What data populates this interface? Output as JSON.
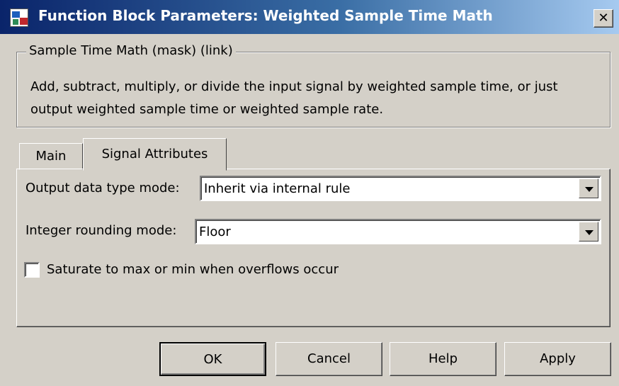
{
  "window": {
    "title": "Function Block Parameters: Weighted Sample Time Math",
    "close_glyph": "✕"
  },
  "group": {
    "legend": "Sample Time Math (mask) (link)",
    "description": "Add, subtract, multiply, or divide the input signal by weighted sample time, or just output weighted sample time or weighted sample rate."
  },
  "tabs": [
    {
      "label": "Main",
      "active": false
    },
    {
      "label": "Signal Attributes",
      "active": true
    }
  ],
  "fields": {
    "output_data_type": {
      "label": "Output data type mode:",
      "value": "Inherit via internal rule"
    },
    "integer_rounding": {
      "label": "Integer rounding mode:",
      "value": "Floor"
    },
    "saturate": {
      "label": "Saturate to max or min when overflows occur",
      "checked": false
    }
  },
  "buttons": {
    "ok": "OK",
    "cancel": "Cancel",
    "help": "Help",
    "apply": "Apply"
  }
}
